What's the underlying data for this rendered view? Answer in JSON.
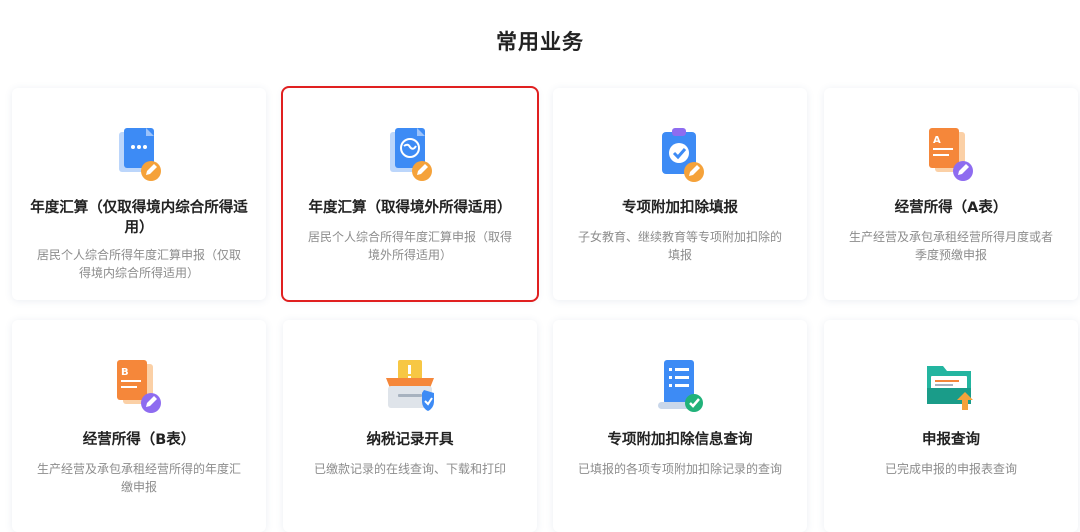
{
  "page": {
    "title": "常用业务"
  },
  "cards": [
    {
      "title": "年度汇算（仅取得境内综合所得适用）",
      "desc": "居民个人综合所得年度汇算申报（仅取得境内综合所得适用）",
      "icon": "document-edit-icon"
    },
    {
      "title": "年度汇算（取得境外所得适用）",
      "desc": "居民个人综合所得年度汇算申报（取得境外所得适用）",
      "icon": "globe-document-icon"
    },
    {
      "title": "专项附加扣除填报",
      "desc": "子女教育、继续教育等专项附加扣除的填报",
      "icon": "clipboard-check-icon"
    },
    {
      "title": "经营所得（A表）",
      "desc": "生产经营及承包承租经营所得月度或者季度预缴申报",
      "icon": "form-a-icon"
    },
    {
      "title": "经营所得（B表）",
      "desc": "生产经营及承包承租经营所得的年度汇缴申报",
      "icon": "form-b-icon"
    },
    {
      "title": "纳税记录开具",
      "desc": "已缴款记录的在线查询、下载和打印",
      "icon": "tax-record-icon"
    },
    {
      "title": "专项附加扣除信息查询",
      "desc": "已填报的各项专项附加扣除记录的查询",
      "icon": "list-scroll-icon"
    },
    {
      "title": "申报查询",
      "desc": "已完成申报的申报表查询",
      "icon": "folder-upload-icon"
    }
  ],
  "colors": {
    "selected_border": "#e02020",
    "blue": "#3d8bf5",
    "orange": "#f5a23a",
    "purple": "#8e6cf0",
    "teal": "#23b5a0",
    "green": "#21b27a"
  }
}
